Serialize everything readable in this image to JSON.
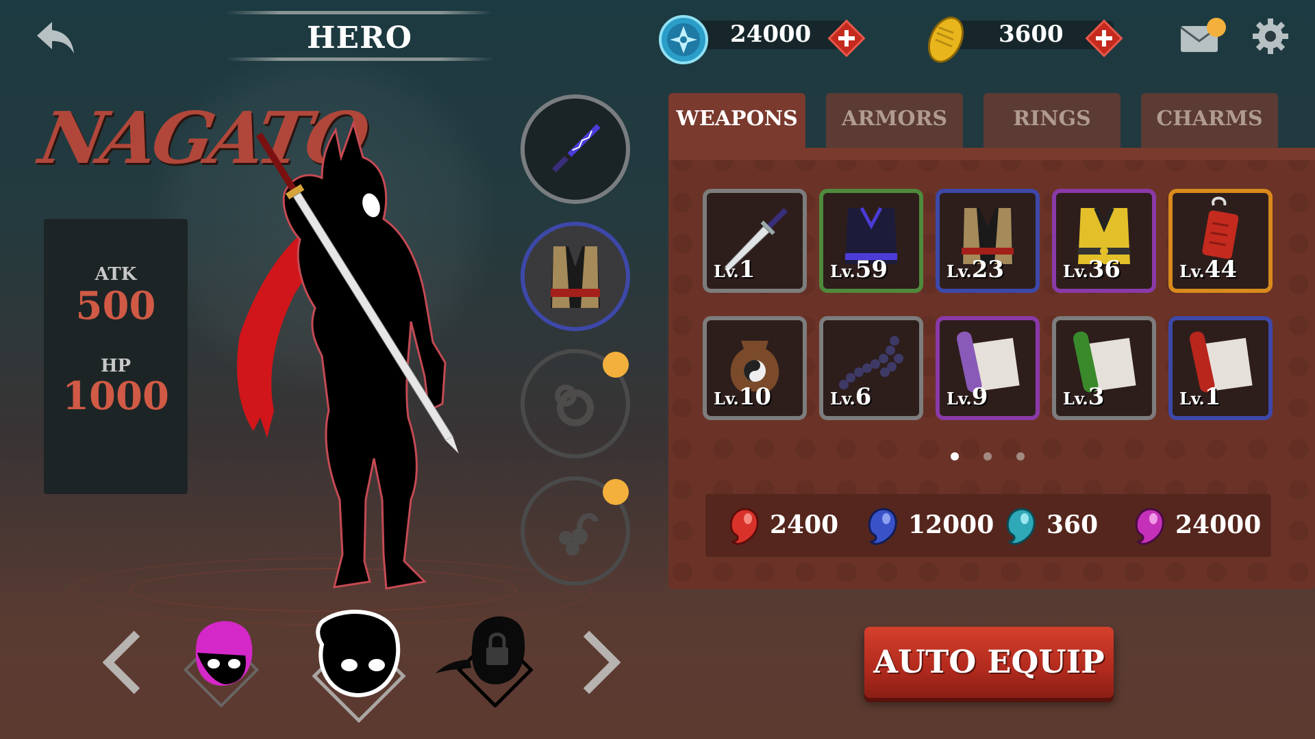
{
  "header": {
    "title": "HERO",
    "shuriken_coins": "24000",
    "gold": "3600"
  },
  "hero": {
    "name": "NAGATO",
    "stats": [
      {
        "label": "ATK",
        "value": "500"
      },
      {
        "label": "HP",
        "value": "1000"
      }
    ]
  },
  "tabs": [
    {
      "label": "WEAPONS",
      "active": true
    },
    {
      "label": "ARMORS",
      "active": false
    },
    {
      "label": "RINGS",
      "active": false
    },
    {
      "label": "CHARMS",
      "active": false
    }
  ],
  "items": [
    {
      "icon": "katana-icon",
      "lv_prefix": "Lv.",
      "level": "1",
      "rarity_color": "#7d7d7d"
    },
    {
      "icon": "ninja-vest-icon",
      "lv_prefix": "Lv.",
      "level": "59",
      "rarity_color": "#4f8a3c"
    },
    {
      "icon": "leather-armor-icon",
      "lv_prefix": "Lv.",
      "level": "23",
      "rarity_color": "#3d48a8"
    },
    {
      "icon": "gold-armor-icon",
      "lv_prefix": "Lv.",
      "level": "36",
      "rarity_color": "#8a3aa8"
    },
    {
      "icon": "red-charm-icon",
      "lv_prefix": "Lv.",
      "level": "44",
      "rarity_color": "#d98a1c"
    },
    {
      "icon": "yin-yang-bag-icon",
      "lv_prefix": "Lv.",
      "level": "10",
      "rarity_color": "#7d7d7d"
    },
    {
      "icon": "prayer-beads-icon",
      "lv_prefix": "Lv.",
      "level": "6",
      "rarity_color": "#7d7d7d"
    },
    {
      "icon": "purple-scroll-icon",
      "lv_prefix": "Lv.",
      "level": "9",
      "rarity_color": "#8a3aa8"
    },
    {
      "icon": "green-scroll-icon",
      "lv_prefix": "Lv.",
      "level": "3",
      "rarity_color": "#7d7d7d"
    },
    {
      "icon": "red-scroll-icon",
      "lv_prefix": "Lv.",
      "level": "1",
      "rarity_color": "#3d48a8"
    }
  ],
  "pagination": {
    "current": 1,
    "total": 3
  },
  "resources": [
    {
      "icon": "red-soul-icon",
      "value": "2400",
      "color": "#d8322a"
    },
    {
      "icon": "blue-soul-icon",
      "value": "12000",
      "color": "#3a52c8"
    },
    {
      "icon": "cyan-soul-icon",
      "value": "360",
      "color": "#2fa8b8"
    },
    {
      "icon": "magenta-soul-icon",
      "value": "24000",
      "color": "#c431b8"
    }
  ],
  "auto_equip_label": "AUTO EQUIP",
  "colors": {
    "accent_red": "#b0473a",
    "notice_dot": "#f3b03c",
    "panel": "#6b3327"
  }
}
